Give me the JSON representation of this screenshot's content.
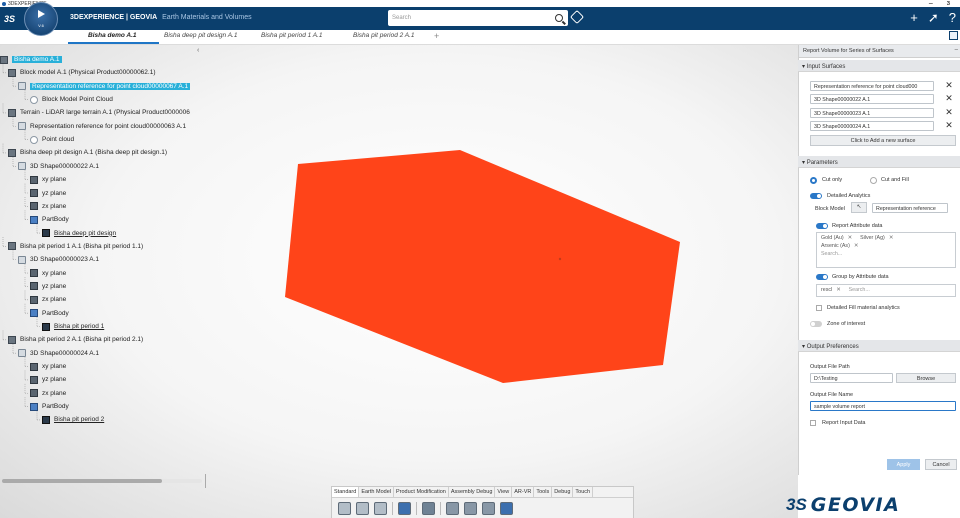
{
  "os_title": "3DEXPERIENCE",
  "window_controls": {
    "minimize": "–",
    "close": "ɜ"
  },
  "header": {
    "brand_bold": "3DEXPERIENCE | GEOVIA",
    "app_name": "Earth Materials and Volumes",
    "compass_version": "V.6",
    "search_placeholder": "Search",
    "actions": [
      "+",
      "➚",
      "?"
    ]
  },
  "tabs": [
    {
      "label": "Bisha demo A.1",
      "active": true
    },
    {
      "label": "Bisha deep pit design A.1",
      "active": false
    },
    {
      "label": "Bisha pit period 1 A.1",
      "active": false
    },
    {
      "label": "Bisha pit period 2 A.1",
      "active": false
    }
  ],
  "tab_add": "+",
  "tree": {
    "collapse_glyph": "‹",
    "items": [
      {
        "label": "Bisha demo A.1",
        "icon": "product-icon",
        "highlight": true,
        "underline": false
      },
      {
        "label": "Block model A.1 (Physical Product00000062.1)",
        "icon": "product-icon",
        "highlight": false,
        "underline": false
      },
      {
        "label": "Representation reference for point cloud00000067 A.1",
        "icon": "shape-icon",
        "highlight": true,
        "underline": false
      },
      {
        "label": "Block Model Point Cloud",
        "icon": "cloud-icon",
        "highlight": false,
        "underline": false
      },
      {
        "label": "Terrain - LiDAR large terrain A.1 (Physical Product0000006",
        "icon": "product-icon",
        "highlight": false,
        "underline": false
      },
      {
        "label": "Representation reference for point cloud00000063 A.1",
        "icon": "shape-icon",
        "highlight": false,
        "underline": false
      },
      {
        "label": "Point cloud",
        "icon": "cloud-icon",
        "highlight": false,
        "underline": false
      },
      {
        "label": "Bisha deep pit design A.1 (Bisha deep pit design.1)",
        "icon": "product-icon",
        "highlight": false,
        "underline": false
      },
      {
        "label": "3D Shape00000022 A.1",
        "icon": "shape-icon",
        "highlight": false,
        "underline": false
      },
      {
        "label": "xy plane",
        "icon": "plane-icon",
        "highlight": false,
        "underline": false
      },
      {
        "label": "yz plane",
        "icon": "plane-icon",
        "highlight": false,
        "underline": false
      },
      {
        "label": "zx plane",
        "icon": "plane-icon",
        "highlight": false,
        "underline": false
      },
      {
        "label": "PartBody",
        "icon": "body-icon",
        "highlight": false,
        "underline": false
      },
      {
        "label": "Bisha deep pit design",
        "icon": "sketch-icon",
        "highlight": false,
        "underline": true
      },
      {
        "label": "Bisha pit period 1 A.1 (Bisha pit period 1.1)",
        "icon": "product-icon",
        "highlight": false,
        "underline": false
      },
      {
        "label": "3D Shape00000023 A.1",
        "icon": "shape-icon",
        "highlight": false,
        "underline": false
      },
      {
        "label": "xy plane",
        "icon": "plane-icon",
        "highlight": false,
        "underline": false
      },
      {
        "label": "yz plane",
        "icon": "plane-icon",
        "highlight": false,
        "underline": false
      },
      {
        "label": "zx plane",
        "icon": "plane-icon",
        "highlight": false,
        "underline": false
      },
      {
        "label": "PartBody",
        "icon": "body-icon",
        "highlight": false,
        "underline": false
      },
      {
        "label": "Bisha pit period 1",
        "icon": "sketch-icon",
        "highlight": false,
        "underline": true
      },
      {
        "label": "Bisha pit period 2 A.1 (Bisha pit period 2.1)",
        "icon": "product-icon",
        "highlight": false,
        "underline": false
      },
      {
        "label": "3D Shape00000024 A.1",
        "icon": "shape-icon",
        "highlight": false,
        "underline": false
      },
      {
        "label": "xy plane",
        "icon": "plane-icon",
        "highlight": false,
        "underline": false
      },
      {
        "label": "yz plane",
        "icon": "plane-icon",
        "highlight": false,
        "underline": false
      },
      {
        "label": "zx plane",
        "icon": "plane-icon",
        "highlight": false,
        "underline": false
      },
      {
        "label": "PartBody",
        "icon": "body-icon",
        "highlight": false,
        "underline": false
      },
      {
        "label": "Bisha pit period 2",
        "icon": "sketch-icon",
        "highlight": false,
        "underline": true
      }
    ]
  },
  "viewport": {
    "shape_color": "#ff4419"
  },
  "action_bar": {
    "tabs": [
      "Standard",
      "Earth Model",
      "Product Modification",
      "Assembly Debug",
      "View",
      "AR-VR",
      "Tools",
      "Debug",
      "Touch"
    ],
    "active_tab": "Standard"
  },
  "panel": {
    "title": "Report Volume for Series of Surfaces",
    "pin": "–",
    "input_surfaces": {
      "header": "Input Surfaces",
      "items": [
        "Representation reference for point cloud000",
        "3D Shape00000022 A.1",
        "3D Shape00000023 A.1",
        "3D Shape00000024 A.1"
      ],
      "remove_glyph": "✕",
      "add_label": "Click to Add a new surface"
    },
    "parameters": {
      "header": "Parameters",
      "cut_only": "Cut only",
      "cut_and_fill": "Cut and Fill",
      "detailed_analytics": "Detailed Analytics",
      "block_model_label": "Block Model",
      "block_model_value": "Representation reference",
      "report_attribute_label": "Report Attribute data",
      "attributes": [
        "Gold (Au)",
        "Silver (Ag)",
        "Arsenic (As)"
      ],
      "attr_search": "Search...",
      "group_by_label": "Group by Attribute data",
      "group_chip": "rescl",
      "group_search": "Search...",
      "detailed_fill": "Detailed Fill material analytics",
      "zone_of_interest": "Zone of interest"
    },
    "output": {
      "header": "Output Preferences",
      "path_label": "Output File Path",
      "path_value": "D:\\Testing",
      "browse": "Browse",
      "name_label": "Output File Name",
      "name_value": "sample volume report",
      "report_input": "Report Input Data"
    },
    "apply": "Apply",
    "cancel": "Cancel"
  },
  "logo": {
    "mark": "3S",
    "word": "GEOVIA"
  }
}
